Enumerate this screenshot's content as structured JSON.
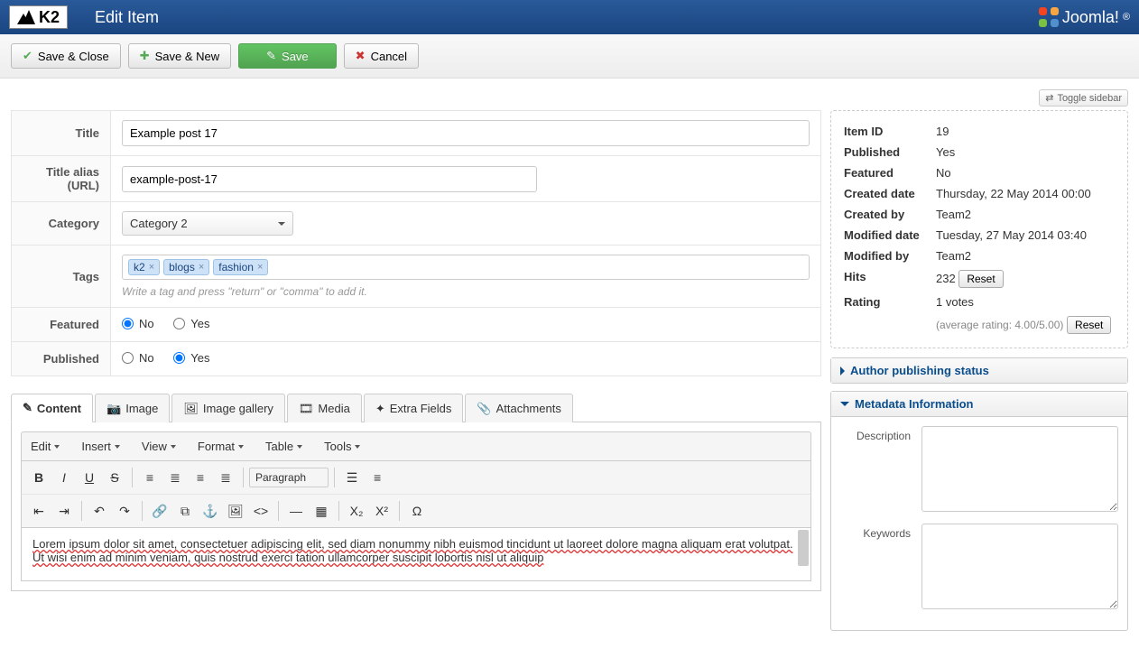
{
  "header": {
    "logo_text": "K2",
    "page_title": "Edit Item",
    "joomla_text": "Joomla!"
  },
  "toolbar": {
    "save_close": "Save & Close",
    "save_new": "Save & New",
    "save": "Save",
    "cancel": "Cancel"
  },
  "toggle_sidebar": "Toggle sidebar",
  "form": {
    "title_label": "Title",
    "title_value": "Example post 17",
    "alias_label": "Title alias (URL)",
    "alias_value": "example-post-17",
    "category_label": "Category",
    "category_value": "Category 2",
    "tags_label": "Tags",
    "tags": [
      "k2",
      "blogs",
      "fashion"
    ],
    "tags_hint": "Write a tag and press \"return\" or \"comma\" to add it.",
    "featured_label": "Featured",
    "published_label": "Published",
    "no": "No",
    "yes": "Yes"
  },
  "tabs": {
    "content": "Content",
    "image": "Image",
    "gallery": "Image gallery",
    "media": "Media",
    "extra": "Extra Fields",
    "attachments": "Attachments"
  },
  "editor_menus": {
    "edit": "Edit",
    "insert": "Insert",
    "view": "View",
    "format": "Format",
    "table": "Table",
    "tools": "Tools",
    "paragraph": "Paragraph"
  },
  "editor_text": "Lorem ipsum dolor sit amet, consectetuer adipiscing elit, sed diam nonummy nibh euismod tincidunt ut laoreet dolore magna aliquam erat volutpat. Ut wisi enim ad minim veniam, quis nostrud exerci tation ullamcorper suscipit lobortis nisl ut aliquip",
  "sidebar": {
    "item_id_label": "Item ID",
    "item_id": "19",
    "published_label": "Published",
    "published": "Yes",
    "featured_label": "Featured",
    "featured": "No",
    "created_date_label": "Created date",
    "created_date": "Thursday, 22 May 2014 00:00",
    "created_by_label": "Created by",
    "created_by": "Team2",
    "modified_date_label": "Modified date",
    "modified_date": "Tuesday, 27 May 2014 03:40",
    "modified_by_label": "Modified by",
    "modified_by": "Team2",
    "hits_label": "Hits",
    "hits": "232",
    "rating_label": "Rating",
    "rating": "1 votes",
    "rating_avg": "(average rating: 4.00/5.00)",
    "reset": "Reset"
  },
  "accordion": {
    "author_status": "Author publishing status",
    "metadata": "Metadata Information",
    "description_label": "Description",
    "keywords_label": "Keywords"
  }
}
